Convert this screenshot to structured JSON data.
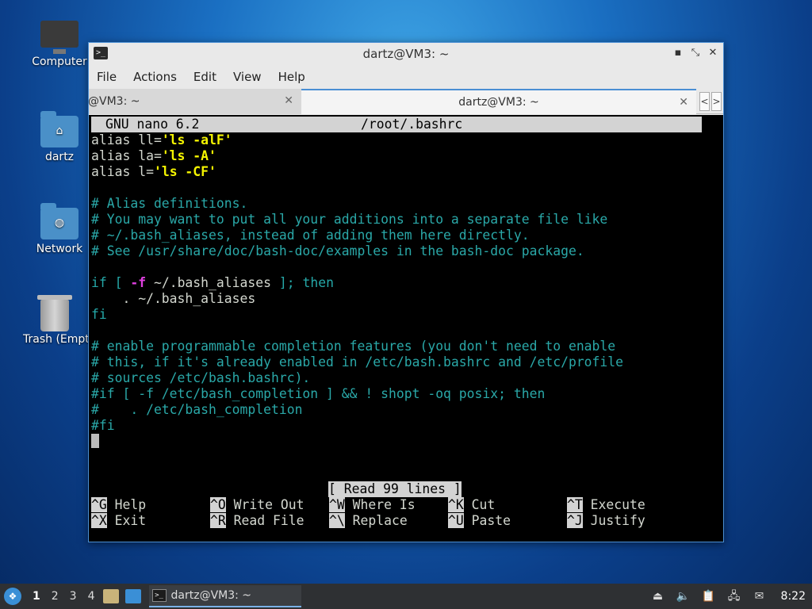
{
  "desktop": {
    "icons": [
      {
        "label": "Computer",
        "icon": "computer-icon"
      },
      {
        "label": "dartz",
        "icon": "home-folder-icon"
      },
      {
        "label": "Network",
        "icon": "network-folder-icon"
      },
      {
        "label": "Trash (Empty)",
        "icon": "trash-icon"
      }
    ]
  },
  "window": {
    "title": "dartz@VM3: ~",
    "controls": {
      "minimize": "▪",
      "maximize": "⤡",
      "close": "✕"
    },
    "menu": [
      "File",
      "Actions",
      "Edit",
      "View",
      "Help"
    ],
    "tabs": [
      {
        "label": "@VM3: ~",
        "close": "✕"
      },
      {
        "label": "dartz@VM3: ~",
        "close": "✕"
      }
    ],
    "tab_scroll": {
      "left": "<",
      "right": ">"
    }
  },
  "nano": {
    "version": "GNU nano 6.2",
    "file": "/root/.bashrc",
    "lines": [
      "alias ll='ls -alF'",
      "alias la='ls -A'",
      "alias l='ls -CF'",
      "",
      "# Alias definitions.",
      "# You may want to put all your additions into a separate file like",
      "# ~/.bash_aliases, instead of adding them here directly.",
      "# See /usr/share/doc/bash-doc/examples in the bash-doc package.",
      "",
      "if [ -f ~/.bash_aliases ]; then",
      "    . ~/.bash_aliases",
      "fi",
      "",
      "# enable programmable completion features (you don't need to enable",
      "# this, if it's already enabled in /etc/bash.bashrc and /etc/profile",
      "# sources /etc/bash.bashrc).",
      "#if [ -f /etc/bash_completion ] && ! shopt -oq posix; then",
      "#    . /etc/bash_completion",
      "#fi"
    ],
    "status": "[ Read 99 lines ]",
    "shortcuts": [
      {
        "key": "^G",
        "label": "Help"
      },
      {
        "key": "^O",
        "label": "Write Out"
      },
      {
        "key": "^W",
        "label": "Where Is"
      },
      {
        "key": "^K",
        "label": "Cut"
      },
      {
        "key": "^T",
        "label": "Execute"
      },
      {
        "key": "^X",
        "label": "Exit"
      },
      {
        "key": "^R",
        "label": "Read File"
      },
      {
        "key": "^\\",
        "label": "Replace"
      },
      {
        "key": "^U",
        "label": "Paste"
      },
      {
        "key": "^J",
        "label": "Justify"
      }
    ]
  },
  "taskbar": {
    "workspaces": [
      "1",
      "2",
      "3",
      "4"
    ],
    "task_label": "dartz@VM3: ~",
    "clock": "8:22"
  }
}
